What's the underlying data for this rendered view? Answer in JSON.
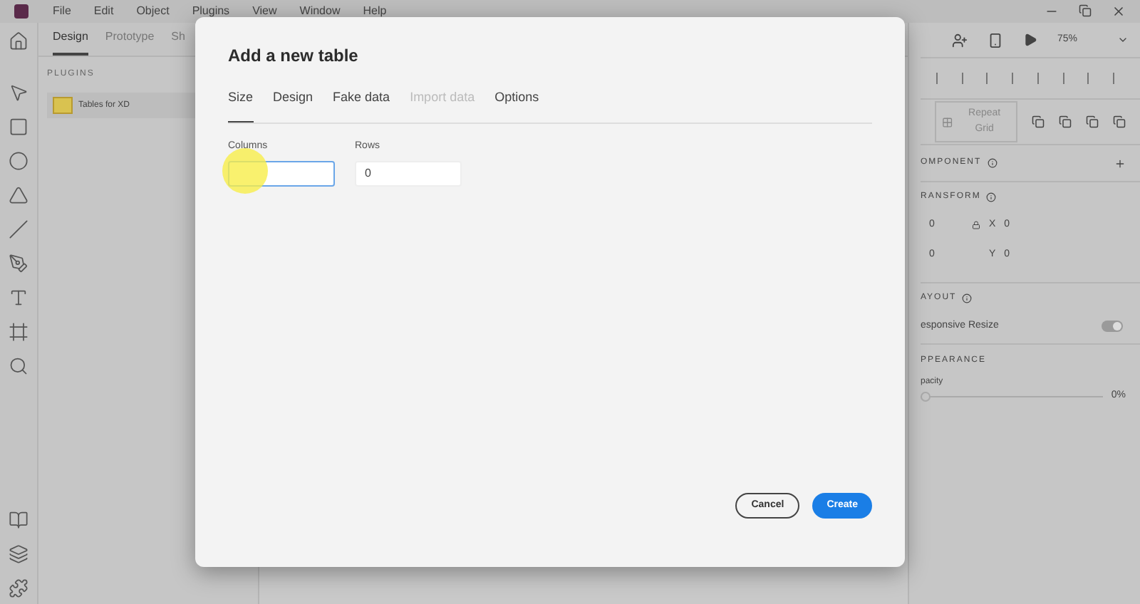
{
  "menu": [
    "File",
    "Edit",
    "Object",
    "Plugins",
    "View",
    "Window",
    "Help"
  ],
  "mode_tabs": [
    {
      "label": "Design",
      "selected": true
    },
    {
      "label": "Prototype",
      "selected": false
    },
    {
      "label": "Sh",
      "selected": false
    }
  ],
  "plugins_panel": {
    "heading": "PLUGINS",
    "items": [
      {
        "label": "Tables for XD"
      }
    ]
  },
  "right_panel": {
    "zoom": "75%",
    "repeat_grid": "Repeat Grid",
    "component": "OMPONENT",
    "transform": "RANSFORM",
    "fields": [
      {
        "value": "0",
        "label": "X",
        "label_value": "0"
      },
      {
        "value": "0",
        "label": "Y",
        "label_value": "0"
      }
    ],
    "layout": "AYOUT",
    "responsive_resize": {
      "label": "esponsive Resize",
      "on": true
    },
    "appearance": "PPEARANCE",
    "opacity": {
      "label": "pacity",
      "reading": "0%",
      "level": 0
    }
  },
  "dialog": {
    "title": "Add a new table",
    "tabs": [
      {
        "label": "Size",
        "selected": true,
        "disabled": false
      },
      {
        "label": "Design",
        "selected": false,
        "disabled": false
      },
      {
        "label": "Fake data",
        "selected": false,
        "disabled": false
      },
      {
        "label": "Import data",
        "selected": false,
        "disabled": true
      },
      {
        "label": "Options",
        "selected": false,
        "disabled": false
      }
    ],
    "fields": [
      {
        "label": "Columns",
        "focused": true
      },
      {
        "label": "Rows",
        "value": "0",
        "focused": false
      }
    ],
    "buttons": [
      {
        "label": "Cancel",
        "kind": "secondary"
      },
      {
        "label": "Create",
        "kind": "primary"
      }
    ]
  }
}
